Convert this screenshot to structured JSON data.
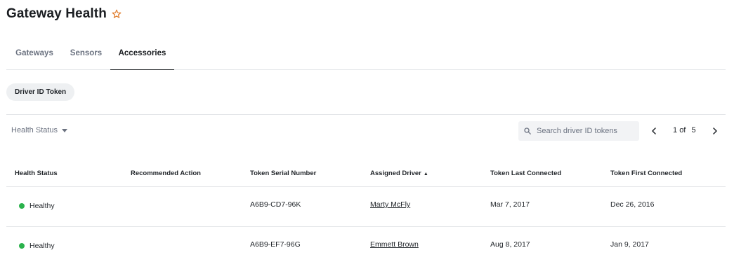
{
  "header": {
    "title": "Gateway Health",
    "favorite_icon": "star-outline-icon",
    "star_color": "#e07b2a"
  },
  "tabs": [
    {
      "label": "Gateways",
      "active": false
    },
    {
      "label": "Sensors",
      "active": false
    },
    {
      "label": "Accessories",
      "active": true
    }
  ],
  "chip": {
    "label": "Driver ID Token"
  },
  "toolbar": {
    "filter_label": "Health Status",
    "filter_icon": "caret-down-icon",
    "search_placeholder": "Search driver ID tokens",
    "search_icon": "search-icon",
    "pagination": {
      "current": "1",
      "of_label": "of",
      "total": "5"
    }
  },
  "table": {
    "columns": [
      "Health Status",
      "Recommended Action",
      "Token Serial Number",
      "Assigned Driver",
      "Token Last Connected",
      "Token First Connected"
    ],
    "sort_indicator": "▲",
    "rows": [
      {
        "status": "Healthy",
        "status_color": "#2bb24c",
        "action": "",
        "serial": "A6B9-CD7-96K",
        "driver": "Marty McFly",
        "last": "Mar 7, 2017",
        "first": "Dec 26, 2016"
      },
      {
        "status": "Healthy",
        "status_color": "#2bb24c",
        "action": "",
        "serial": "A6B9-EF7-96G",
        "driver": "Emmett Brown",
        "last": "Aug 8, 2017",
        "first": "Jan 9, 2017"
      }
    ]
  }
}
